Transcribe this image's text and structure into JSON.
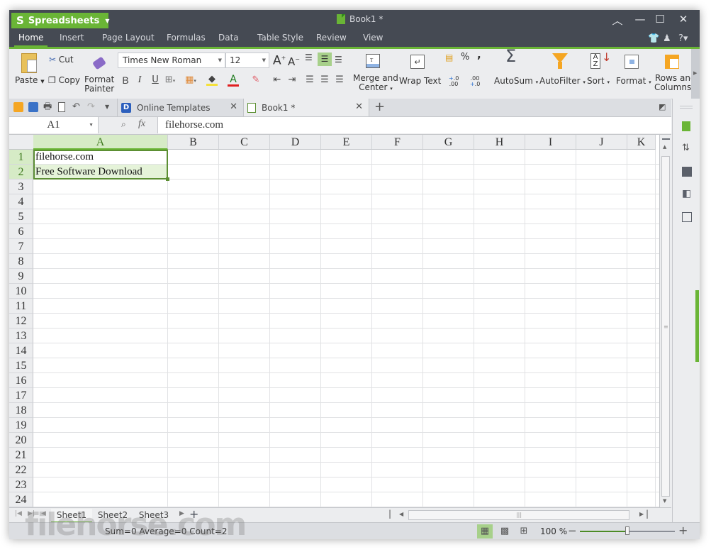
{
  "app": {
    "name": "Spreadsheets",
    "document_title": "Book1 *",
    "accent_color": "#6ab536",
    "titlebar_color": "#454a53"
  },
  "window_controls": {
    "collapse": "^",
    "minimize": "—",
    "maximize": "☐",
    "close": "✕"
  },
  "menu": {
    "tabs": [
      "Home",
      "Insert",
      "Page Layout",
      "Formulas",
      "Data",
      "Table Style",
      "Review",
      "View"
    ],
    "active": "Home",
    "right_icons": [
      "skin-icon",
      "account-icon",
      "help-icon"
    ]
  },
  "ribbon": {
    "paste": "Paste",
    "cut": "Cut",
    "copy": "Copy",
    "format_painter_1": "Format",
    "format_painter_2": "Painter",
    "font_name": "Times New Roman",
    "font_size": "12",
    "bold": "B",
    "italic": "I",
    "underline": "U",
    "merge_1": "Merge and",
    "merge_2": "Center",
    "wrap_text": "Wrap Text",
    "percent": "%",
    "comma": ",",
    "inc_decimal": "+.0 .00",
    "dec_decimal": ".00 +.0",
    "autosum": "AutoSum",
    "autofilter": "AutoFilter",
    "sort": "Sort",
    "format": "Format",
    "rows_cols_1": "Rows and",
    "rows_cols_2": "Columns"
  },
  "doc_tabs": [
    {
      "label": "Online Templates",
      "active": false
    },
    {
      "label": "Book1 *",
      "active": true
    }
  ],
  "formula_bar": {
    "name_box": "A1",
    "fx": "fx",
    "formula": "filehorse.com"
  },
  "grid": {
    "columns": [
      "A",
      "B",
      "C",
      "D",
      "E",
      "F",
      "G",
      "H",
      "I",
      "J",
      "K"
    ],
    "selected_column": "A",
    "rows": [
      "1",
      "2",
      "3",
      "4",
      "5",
      "6",
      "7",
      "8",
      "9",
      "10",
      "11",
      "12",
      "13",
      "14",
      "15",
      "16",
      "17",
      "18",
      "19",
      "20",
      "21",
      "22",
      "23",
      "24"
    ],
    "selected_rows": [
      "1",
      "2"
    ],
    "cells": {
      "A1": "filehorse.com",
      "A2": "Free Software Download"
    }
  },
  "sheets": {
    "tabs": [
      "Sheet1",
      "Sheet2",
      "Sheet3"
    ],
    "active": "Sheet1",
    "add": "+"
  },
  "status": {
    "summary": "Sum=0  Average=0  Count=2",
    "zoom": "100 %",
    "zoom_percent": 100,
    "zoom_slider_fraction": 0.5
  }
}
